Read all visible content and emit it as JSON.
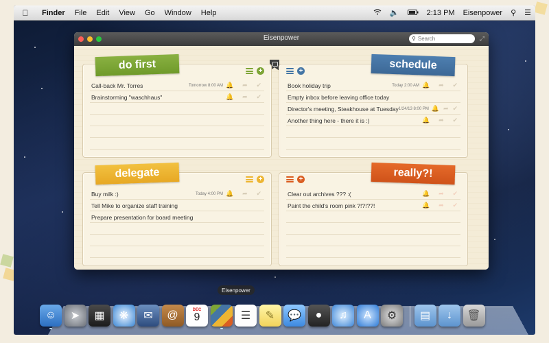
{
  "menubar": {
    "apple_icon": "apple-icon",
    "items": [
      "Finder",
      "File",
      "Edit",
      "View",
      "Go",
      "Window",
      "Help"
    ],
    "time": "2:13 PM",
    "user": "Eisenpower"
  },
  "window": {
    "title": "Eisenpower",
    "search_placeholder": "Search"
  },
  "quadrants": [
    {
      "label": "do first",
      "color": "#7ea537",
      "tasks": [
        {
          "text": "Call-back Mr. Torres",
          "date": "Tomorrow 8:00 AM",
          "alert": true
        },
        {
          "text": "Brainstorming \"waschhaus\"",
          "date": "",
          "alert": false
        }
      ]
    },
    {
      "label": "schedule",
      "color": "#4576a5",
      "tasks": [
        {
          "text": "Book holiday trip",
          "date": "Today 2:00 AM",
          "alert": true
        },
        {
          "text": "Empty inbox before leaving office today",
          "date": "",
          "alert": false
        },
        {
          "text": "Director's meeting, Steakhouse at Tuesday",
          "date": "1/24/13 8:00 PM",
          "alert": true
        },
        {
          "text": "Another thing here - there it is :)",
          "date": "",
          "alert": false
        }
      ]
    },
    {
      "label": "delegate",
      "color": "#edb532",
      "tasks": [
        {
          "text": "Buy milk :)",
          "date": "Today 4:00 PM",
          "alert": true
        },
        {
          "text": "Tell Mike to organize staff training",
          "date": "",
          "alert": false
        },
        {
          "text": "Prepare presentation for board meeting",
          "date": "",
          "alert": false
        }
      ]
    },
    {
      "label": "really?!",
      "color": "#da5e22",
      "tasks": [
        {
          "text": "Clear out archives ??? :(",
          "date": "",
          "alert": false
        },
        {
          "text": "Paint the child's room pink ?!?!??!",
          "date": "",
          "alert": false
        }
      ]
    }
  ],
  "dock": {
    "tooltip": "Eisenpower",
    "calendar_month": "DEC",
    "calendar_day": "9"
  }
}
